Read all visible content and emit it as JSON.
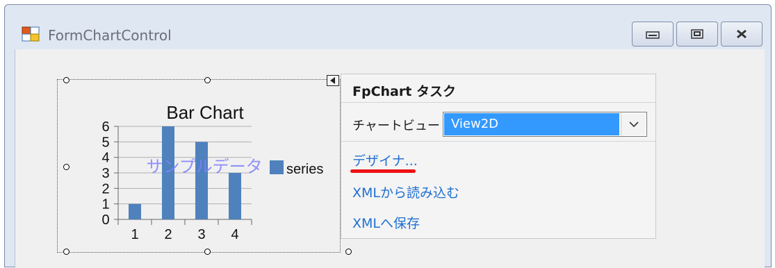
{
  "window": {
    "title": "FormChartControl"
  },
  "chart_data": {
    "type": "bar",
    "title": "Bar Chart",
    "categories": [
      "1",
      "2",
      "3",
      "4"
    ],
    "values": [
      1,
      6,
      5,
      3
    ],
    "yticks": [
      "0",
      "1",
      "2",
      "3",
      "4",
      "5",
      "6"
    ],
    "ylim": [
      0,
      6
    ],
    "series": [
      {
        "name": "series",
        "values": [
          1,
          6,
          5,
          3
        ]
      }
    ],
    "legend_position": "right",
    "watermark_text": "サンプルデータ",
    "bar_color": "#4f81bd"
  },
  "task_panel": {
    "title": "FpChart タスク",
    "view_label": "チャートビュー",
    "view_value": "View2D",
    "links": {
      "designer": "デザイナ...",
      "load_xml": "XMLから読み込む",
      "save_xml": "XMLへ保存"
    }
  },
  "colors": {
    "link": "#1f6fd1",
    "selection": "#3399ff",
    "highlight_underline": "#e11111"
  }
}
